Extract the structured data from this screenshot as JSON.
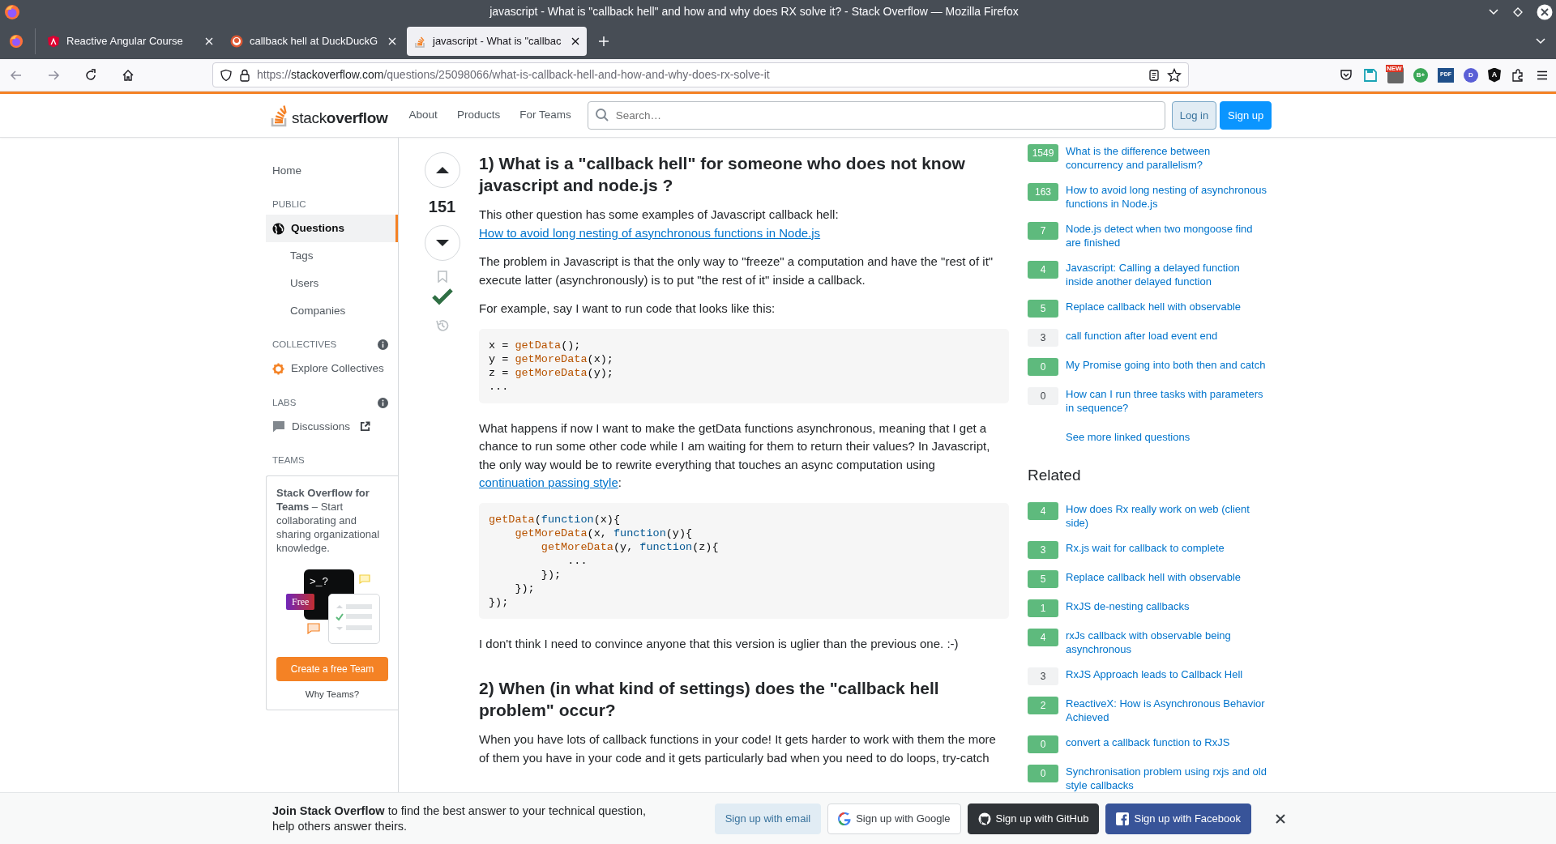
{
  "window": {
    "title": "javascript - What is \"callback hell\" and how and why does RX solve it? - Stack Overflow — Mozilla Firefox"
  },
  "tabs": [
    {
      "label": "Reactive Angular Course",
      "selected": false
    },
    {
      "label": "callback hell at DuckDuckG",
      "selected": false
    },
    {
      "label": "javascript - What is \"callbac",
      "selected": true
    }
  ],
  "address_bar": {
    "scheme": "https://",
    "host": "stackoverflow.com",
    "path": "/questions/25098066/what-is-callback-hell-and-how-and-why-does-rx-solve-it"
  },
  "extensions": [
    {
      "kind": "pocket"
    },
    {
      "kind": "save"
    },
    {
      "kind": "news",
      "label": "NEW"
    },
    {
      "kind": "circle",
      "label": "B+",
      "color": "#3aa757"
    },
    {
      "kind": "square",
      "label": "PDF",
      "color": "#1f4f8a"
    },
    {
      "kind": "circle",
      "label": "D",
      "color": "#5a5fd6"
    },
    {
      "kind": "shield",
      "label": "A",
      "color": "#111111"
    },
    {
      "kind": "puzzle"
    }
  ],
  "site_header": {
    "logo": {
      "light": "stack",
      "bold": "overflow"
    },
    "nav": [
      "About",
      "Products",
      "For Teams"
    ],
    "search": {
      "placeholder": "Search…"
    },
    "buttons": [
      {
        "label": "Log in",
        "kind": "secondary"
      },
      {
        "label": "Sign up",
        "kind": "primary"
      }
    ]
  },
  "sidebar": {
    "items": [
      {
        "kind": "link",
        "label": "Home",
        "selected": false
      },
      {
        "kind": "heading",
        "label": "PUBLIC"
      },
      {
        "kind": "globe-link",
        "label": "Questions",
        "selected": true
      },
      {
        "kind": "sub-link",
        "label": "Tags",
        "selected": false
      },
      {
        "kind": "sub-link",
        "label": "Users",
        "selected": false
      },
      {
        "kind": "sub-link",
        "label": "Companies",
        "selected": false
      },
      {
        "kind": "heading-info",
        "label": "COLLECTIVES"
      },
      {
        "kind": "collective-link",
        "label": "Explore Collectives",
        "selected": false
      },
      {
        "kind": "heading-info",
        "label": "LABS"
      },
      {
        "kind": "discussion-link",
        "label": "Discussions",
        "selected": false
      },
      {
        "kind": "heading",
        "label": "TEAMS"
      }
    ],
    "teams_card": {
      "text": "**Stack Overflow for Teams** – Start collaborating and sharing organizational knowledge.",
      "prompt": ">_?",
      "badge": "Free",
      "button": "Create a free Team",
      "link": "Why Teams?"
    }
  },
  "post": {
    "score": "151",
    "accepted": true,
    "blocks": [
      {
        "kind": "heading",
        "text": "1) What is a \"callback hell\" for someone who does not know javascript and node.js ?"
      },
      {
        "kind": "paragraph",
        "parts": [
          {
            "text": "This other question has some examples of Javascript callback hell: ",
            "link": false
          },
          {
            "text": "How to avoid long nesting of asynchronous functions in Node.js",
            "link": true
          }
        ]
      },
      {
        "kind": "paragraph",
        "parts": [
          {
            "text": "The problem in Javascript is that the only way to \"freeze\" a computation and have the \"rest of it\" execute latter (asynchronously) is to put \"the rest of it\" inside a callback.",
            "link": false
          }
        ]
      },
      {
        "kind": "paragraph",
        "parts": [
          {
            "text": "For example, say I want to run code that looks like this:",
            "link": false
          }
        ]
      },
      {
        "kind": "code",
        "lines": [
          [
            {
              "text": "x = ",
              "kind": "plain"
            },
            {
              "text": "getData",
              "kind": "function"
            },
            {
              "text": "();",
              "kind": "plain"
            }
          ],
          [
            {
              "text": "y = ",
              "kind": "plain"
            },
            {
              "text": "getMoreData",
              "kind": "function"
            },
            {
              "text": "(x);",
              "kind": "plain"
            }
          ],
          [
            {
              "text": "z = ",
              "kind": "plain"
            },
            {
              "text": "getMoreData",
              "kind": "function"
            },
            {
              "text": "(y);",
              "kind": "plain"
            }
          ],
          [
            {
              "text": "...",
              "kind": "plain"
            }
          ]
        ]
      },
      {
        "kind": "paragraph",
        "parts": [
          {
            "text": "What happens if now I want to make the getData functions asynchronous, meaning that I get a chance to run some other code while I am waiting for them to return their values? In Javascript, the only way would be to rewrite everything that touches an async computation using ",
            "link": false
          },
          {
            "text": "continuation passing style",
            "link": true
          },
          {
            "text": ":",
            "link": false
          }
        ]
      },
      {
        "kind": "code",
        "lines": [
          [
            {
              "text": "getData",
              "kind": "function"
            },
            {
              "text": "(",
              "kind": "plain"
            },
            {
              "text": "function",
              "kind": "keyword"
            },
            {
              "text": "(x){",
              "kind": "plain"
            }
          ],
          [
            {
              "text": "    getMoreData",
              "kind": "function"
            },
            {
              "text": "(x, ",
              "kind": "plain"
            },
            {
              "text": "function",
              "kind": "keyword"
            },
            {
              "text": "(y){",
              "kind": "plain"
            }
          ],
          [
            {
              "text": "        getMoreData",
              "kind": "function"
            },
            {
              "text": "(y, ",
              "kind": "plain"
            },
            {
              "text": "function",
              "kind": "keyword"
            },
            {
              "text": "(z){",
              "kind": "plain"
            }
          ],
          [
            {
              "text": "            ...",
              "kind": "plain"
            }
          ],
          [
            {
              "text": "        });",
              "kind": "plain"
            }
          ],
          [
            {
              "text": "    });",
              "kind": "plain"
            }
          ],
          [
            {
              "text": "});",
              "kind": "plain"
            }
          ]
        ]
      },
      {
        "kind": "paragraph",
        "parts": [
          {
            "text": "I don't think I need to convince anyone that this version is uglier than the previous one. :-)",
            "link": false
          }
        ]
      },
      {
        "kind": "heading",
        "text": "2) When (in what kind of settings) does the \"callback hell problem\" occur?"
      },
      {
        "kind": "paragraph",
        "parts": [
          {
            "text": "When you have lots of callback functions in your code! It gets harder to work with them the more of them you have in your code and it gets particularly bad when you need to do loops, try-catch",
            "link": false
          }
        ]
      }
    ]
  },
  "linked": [
    {
      "score": "1549",
      "accepted": true,
      "title": "What is the difference between concurrency and parallelism?"
    },
    {
      "score": "163",
      "accepted": true,
      "title": "How to avoid long nesting of asynchronous functions in Node.js"
    },
    {
      "score": "7",
      "accepted": true,
      "title": "Node.js detect when two mongoose find are finished"
    },
    {
      "score": "4",
      "accepted": true,
      "title": "Javascript: Calling a delayed function inside another delayed function"
    },
    {
      "score": "5",
      "accepted": true,
      "title": "Replace callback hell with observable"
    },
    {
      "score": "3",
      "accepted": false,
      "title": "call function after load event end"
    },
    {
      "score": "0",
      "accepted": true,
      "title": "My Promise going into both then and catch"
    },
    {
      "score": "0",
      "accepted": false,
      "title": "How can I run three tasks with parameters in sequence?"
    }
  ],
  "see_more": "See more linked questions",
  "related_title": "Related",
  "related": [
    {
      "score": "4",
      "accepted": true,
      "title": "How does Rx really work on web (client side)"
    },
    {
      "score": "3",
      "accepted": true,
      "title": "Rx.js wait for callback to complete"
    },
    {
      "score": "5",
      "accepted": true,
      "title": "Replace callback hell with observable"
    },
    {
      "score": "1",
      "accepted": true,
      "title": "RxJS de-nesting callbacks"
    },
    {
      "score": "4",
      "accepted": true,
      "title": "rxJs callback with observable being asynchronous"
    },
    {
      "score": "3",
      "accepted": false,
      "title": "RxJS Approach leads to Callback Hell"
    },
    {
      "score": "2",
      "accepted": true,
      "title": "ReactiveX: How is Asynchronous Behavior Achieved"
    },
    {
      "score": "0",
      "accepted": true,
      "title": "convert a callback function to RxJS"
    },
    {
      "score": "0",
      "accepted": true,
      "title": "Synchronisation problem using rxjs and old style callbacks"
    }
  ],
  "banner": {
    "text": "**Join Stack Overflow** to find the best answer to your technical question, help others answer theirs.",
    "buttons": [
      {
        "kind": "email",
        "label": "Sign up with email"
      },
      {
        "kind": "google",
        "label": "Sign up with Google"
      },
      {
        "kind": "github",
        "label": "Sign up with GitHub"
      },
      {
        "kind": "facebook",
        "label": "Sign up with Facebook"
      }
    ]
  }
}
